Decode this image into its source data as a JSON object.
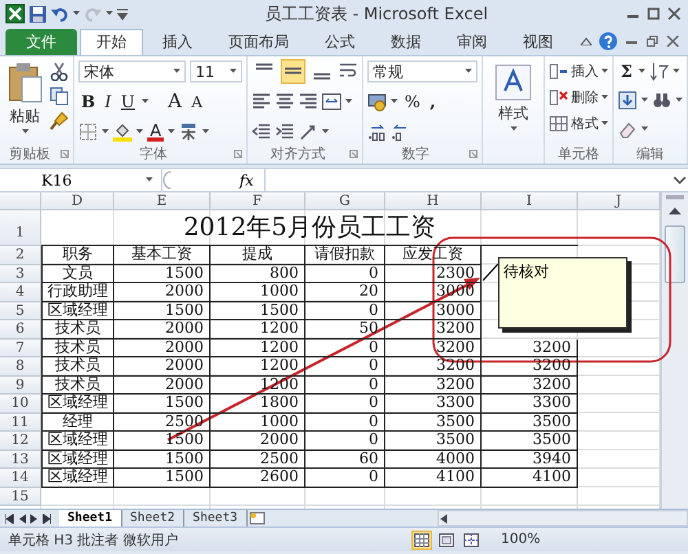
{
  "window": {
    "title": "员工工资表 - Microsoft Excel"
  },
  "tabs": [
    {
      "label": "文件",
      "kind": "file",
      "selected": false
    },
    {
      "label": "开始",
      "kind": "tab",
      "selected": true
    },
    {
      "label": "插入",
      "kind": "tab",
      "selected": false
    },
    {
      "label": "页面布局",
      "kind": "tab",
      "selected": false
    },
    {
      "label": "公式",
      "kind": "tab",
      "selected": false
    },
    {
      "label": "数据",
      "kind": "tab",
      "selected": false
    },
    {
      "label": "审阅",
      "kind": "tab",
      "selected": false
    },
    {
      "label": "视图",
      "kind": "tab",
      "selected": false
    }
  ],
  "ribbon": {
    "groups": [
      {
        "kind": "clipboard",
        "label": "剪贴板",
        "paste": "粘贴"
      },
      {
        "kind": "font",
        "label": "字体",
        "font": "宋体",
        "size": "11",
        "bold": "B",
        "italic": "I",
        "underline": "U",
        "grow": "A",
        "shrink": "A",
        "font_color": "A"
      },
      {
        "kind": "alignment",
        "label": "对齐方式",
        "vertical": [
          {
            "selected": false
          },
          {
            "selected": true
          },
          {
            "selected": false
          }
        ]
      },
      {
        "kind": "number",
        "label": "数字",
        "format": "常规",
        "percent": "%",
        "comma": ","
      },
      {
        "kind": "styles",
        "button": "样式"
      },
      {
        "kind": "cells",
        "label": "单元格",
        "buttons": [
          "插入",
          "删除",
          "格式"
        ]
      },
      {
        "kind": "editing",
        "label": "编辑",
        "sum": "Σ"
      }
    ]
  },
  "formula_bar": {
    "name_box": "K16",
    "function_label": "fx"
  },
  "sheet": {
    "columns": [
      "D",
      "E",
      "F",
      "G",
      "H",
      "I",
      "J"
    ],
    "row_numbers": [
      "1",
      "2",
      "3",
      "4",
      "5",
      "6",
      "7",
      "8",
      "9",
      "10",
      "11",
      "12",
      "13",
      "14",
      "15"
    ],
    "title": "2012年5月份员工工资",
    "headers": [
      "职务",
      "基本工资",
      "提成",
      "请假扣款",
      "应发工资"
    ],
    "rows": [
      [
        "文员",
        "1500",
        "800",
        "0",
        "2300",
        null
      ],
      [
        "行政助理",
        "2000",
        "1000",
        "20",
        "3000",
        null
      ],
      [
        "区域经理",
        "1500",
        "1500",
        "0",
        "3000",
        null
      ],
      [
        "技术员",
        "2000",
        "1200",
        "50",
        "3200",
        null
      ],
      [
        "技术员",
        "2000",
        "1200",
        "0",
        "3200",
        "3200"
      ],
      [
        "技术员",
        "2000",
        "1200",
        "0",
        "3200",
        "3200"
      ],
      [
        "技术员",
        "2000",
        "1200",
        "0",
        "3200",
        "3200"
      ],
      [
        "区域经理",
        "1500",
        "1800",
        "0",
        "3300",
        "3300"
      ],
      [
        "经理",
        "2500",
        "1000",
        "0",
        "3500",
        "3500"
      ],
      [
        "区域经理",
        "1500",
        "2000",
        "0",
        "3500",
        "3500"
      ],
      [
        "区域经理",
        "1500",
        "2500",
        "60",
        "4000",
        "3940"
      ],
      [
        "区域经理",
        "1500",
        "2600",
        "0",
        "4100",
        "4100"
      ]
    ],
    "comment": "待核对"
  },
  "sheet_tabs": [
    {
      "label": "Sheet1",
      "selected": true
    },
    {
      "label": "Sheet2",
      "selected": false
    },
    {
      "label": "Sheet3",
      "selected": false
    }
  ],
  "status_bar": {
    "text": "单元格 H3 批注者 微软用户",
    "views": [
      {
        "selected": true
      },
      {
        "selected": false
      },
      {
        "selected": false
      }
    ],
    "zoom": "100%"
  }
}
